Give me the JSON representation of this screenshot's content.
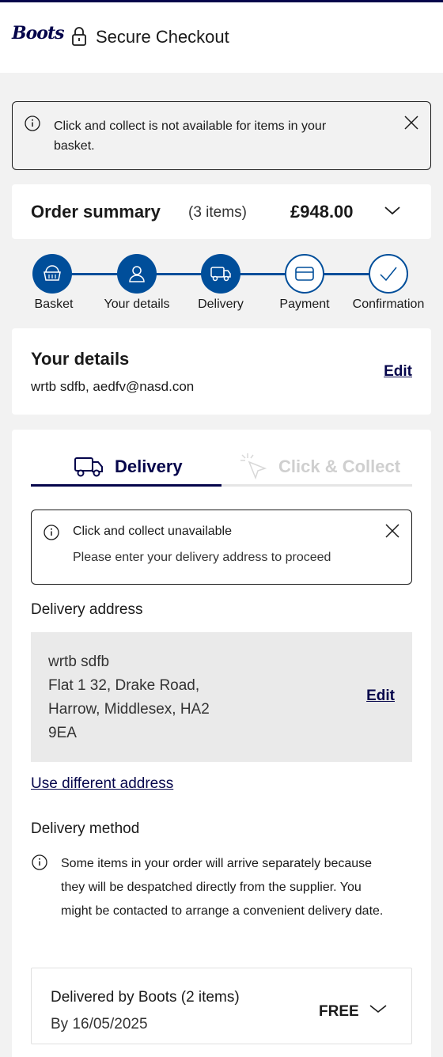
{
  "header": {
    "logo_text": "Boots",
    "title": "Secure Checkout"
  },
  "top_alert": {
    "message": "Click and collect is not available for items in your basket."
  },
  "order_summary": {
    "title": "Order summary",
    "count": "(3 items)",
    "total": "£948.00"
  },
  "stepper": {
    "steps": [
      {
        "label": "Basket",
        "state": "done",
        "icon": "basket-icon"
      },
      {
        "label": "Your details",
        "state": "done",
        "icon": "person-icon"
      },
      {
        "label": "Delivery",
        "state": "done",
        "icon": "van-icon"
      },
      {
        "label": "Payment",
        "state": "todo",
        "icon": "card-icon"
      },
      {
        "label": "Confirmation",
        "state": "todo",
        "icon": "check-icon"
      }
    ],
    "accent_color": "#004e9a"
  },
  "your_details": {
    "title": "Your details",
    "text": "wrtb sdfb, aedfv@nasd.con",
    "edit_label": "Edit"
  },
  "delivery": {
    "tabs": {
      "delivery_label": "Delivery",
      "collect_label": "Click & Collect"
    },
    "alert": {
      "line1": "Click and collect unavailable",
      "line2": "Please enter your delivery address to proceed"
    },
    "address_label": "Delivery address",
    "address_lines": [
      "wrtb sdfb",
      "Flat 1 32, Drake Road,",
      "Harrow, Middlesex, HA2",
      "9EA"
    ],
    "address_edit_label": "Edit",
    "use_different_address": "Use different address",
    "method_label": "Delivery method",
    "note": "Some items in your order will arrive separately because they will be despatched directly from the supplier. You might be contacted to arrange a convenient delivery date.",
    "method": {
      "title": "Delivered by Boots (2 items)",
      "date": "By 16/05/2025",
      "price": "FREE"
    }
  },
  "colors": {
    "brand_navy": "#05054b",
    "step_blue": "#004e9a"
  }
}
